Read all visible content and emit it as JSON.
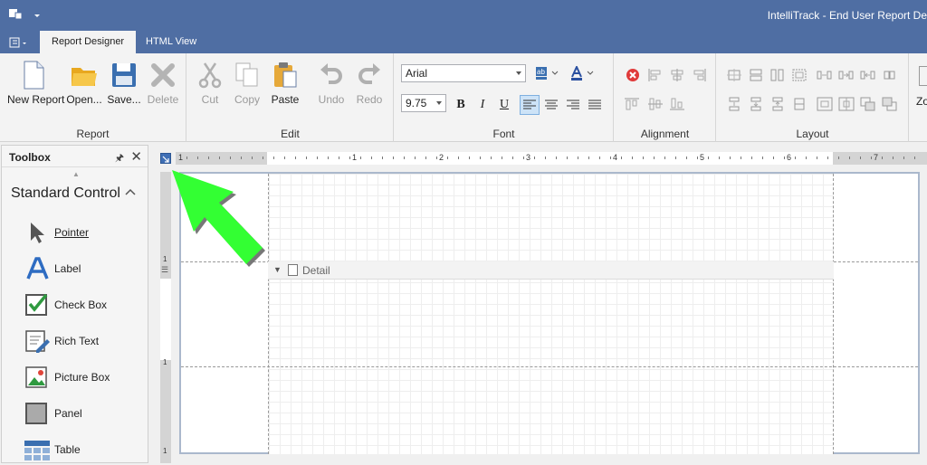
{
  "window": {
    "title": "IntelliTrack - End User Report De"
  },
  "tabs": [
    {
      "label": "Report Designer",
      "active": true
    },
    {
      "label": "HTML View",
      "active": false
    }
  ],
  "ribbon": {
    "report": {
      "label": "Report",
      "buttons": [
        {
          "label": "New Report",
          "icon": "new-document-icon"
        },
        {
          "label": "Open...",
          "icon": "folder-icon"
        },
        {
          "label": "Save...",
          "icon": "floppy-disk-icon"
        },
        {
          "label": "Delete",
          "icon": "delete-x-icon"
        }
      ]
    },
    "edit": {
      "label": "Edit",
      "buttons": [
        {
          "label": "Cut",
          "icon": "scissors-icon"
        },
        {
          "label": "Copy",
          "icon": "copy-icon"
        },
        {
          "label": "Paste",
          "icon": "clipboard-icon"
        },
        {
          "label": "Undo",
          "icon": "undo-icon"
        },
        {
          "label": "Redo",
          "icon": "redo-icon"
        }
      ]
    },
    "font": {
      "label": "Font",
      "family": "Arial",
      "size": "9.75",
      "bold": "B",
      "italic": "I",
      "underline": "U"
    },
    "alignment": {
      "label": "Alignment"
    },
    "layout": {
      "label": "Layout"
    },
    "zoom": {
      "label": "Zo"
    }
  },
  "toolbox": {
    "title": "Toolbox",
    "section": "Standard Control",
    "items": [
      {
        "label": "Pointer",
        "icon": "pointer-icon"
      },
      {
        "label": "Label",
        "icon": "label-a-icon"
      },
      {
        "label": "Check Box",
        "icon": "checkbox-icon"
      },
      {
        "label": "Rich Text",
        "icon": "rich-text-icon"
      },
      {
        "label": "Picture Box",
        "icon": "picture-icon"
      },
      {
        "label": "Panel",
        "icon": "panel-icon"
      },
      {
        "label": "Table",
        "icon": "table-icon"
      }
    ]
  },
  "designer": {
    "band": "Detail",
    "ruler_numbers": [
      "1",
      "1",
      "2",
      "3",
      "4",
      "5",
      "6",
      "7"
    ],
    "vruler_numbers": [
      "1",
      "1",
      "1"
    ]
  },
  "colors": {
    "titlebar": "#4f6ea3",
    "highlight_arrow": "#33ff33"
  }
}
